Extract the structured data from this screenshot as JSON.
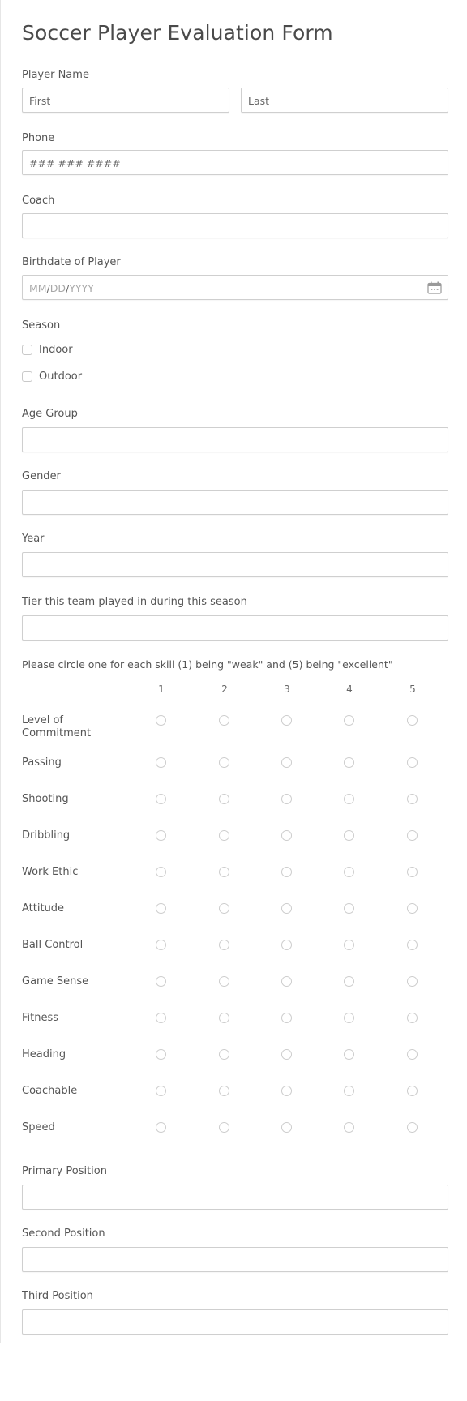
{
  "form": {
    "title": "Soccer Player Evaluation Form",
    "player_name": {
      "label": "Player Name",
      "first_placeholder": "First",
      "last_placeholder": "Last"
    },
    "phone": {
      "label": "Phone",
      "placeholder": "### ### ####"
    },
    "coach": {
      "label": "Coach",
      "value": ""
    },
    "birthdate": {
      "label": "Birthdate of Player",
      "placeholder_parts": [
        "MM",
        "/",
        "DD",
        "/",
        "YYYY"
      ],
      "icon": "calendar-icon"
    },
    "season": {
      "label": "Season",
      "options": [
        {
          "label": "Indoor",
          "checked": false
        },
        {
          "label": "Outdoor",
          "checked": false
        }
      ]
    },
    "age_group": {
      "label": "Age Group",
      "value": ""
    },
    "gender": {
      "label": "Gender",
      "value": ""
    },
    "year": {
      "label": "Year",
      "value": ""
    },
    "tier": {
      "label": "Tier this team played in during this season",
      "value": ""
    },
    "skills": {
      "instructions": "Please circle one for each skill (1) being \"weak\" and (5) being \"excellent\"",
      "scale": [
        "1",
        "2",
        "3",
        "4",
        "5"
      ],
      "rows": [
        "Level of Commitment",
        "Passing",
        "Shooting",
        "Dribbling",
        "Work Ethic",
        "Attitude",
        "Ball Control",
        "Game Sense",
        "Fitness",
        "Heading",
        "Coachable",
        "Speed"
      ]
    },
    "primary_position": {
      "label": "Primary Position",
      "value": ""
    },
    "second_position": {
      "label": "Second Position",
      "value": ""
    },
    "third_position": {
      "label": "Third Position",
      "value": ""
    }
  },
  "colors": {
    "text": "#555555",
    "title": "#4a4a4a",
    "border": "#cfcfcf",
    "placeholder_light": "#a8a8a8"
  }
}
